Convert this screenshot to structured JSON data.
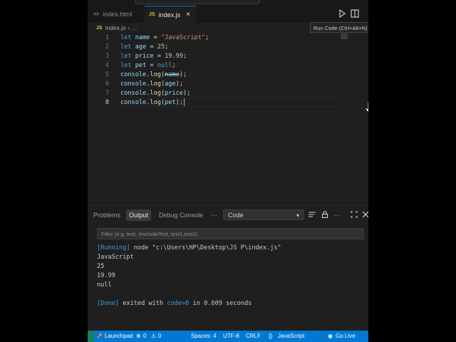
{
  "tabs": [
    {
      "icon": "<>",
      "label": "index.html",
      "active": false
    },
    {
      "icon": "JS",
      "label": "index.js",
      "active": true
    }
  ],
  "breadcrumb": {
    "file": "index.js",
    "sep": "›",
    "rest": "..."
  },
  "tooltip": "Run Code (Ctrl+Alt+N)",
  "editor": {
    "lines": [
      {
        "n": "1",
        "parts": [
          [
            "let",
            "kw"
          ],
          [
            " ",
            ""
          ],
          [
            "name",
            "var"
          ],
          [
            " = ",
            ""
          ],
          [
            "\"JavaScript\"",
            "str"
          ],
          [
            ";",
            ""
          ]
        ]
      },
      {
        "n": "2",
        "parts": [
          [
            "let",
            "kw"
          ],
          [
            " ",
            ""
          ],
          [
            "age",
            "var"
          ],
          [
            " = ",
            ""
          ],
          [
            "25",
            "num"
          ],
          [
            ";",
            ""
          ]
        ]
      },
      {
        "n": "3",
        "parts": [
          [
            "let",
            "kw"
          ],
          [
            " ",
            ""
          ],
          [
            "price",
            "var"
          ],
          [
            " = ",
            ""
          ],
          [
            "19.99",
            "num"
          ],
          [
            ";",
            ""
          ]
        ]
      },
      {
        "n": "4",
        "parts": [
          [
            "let",
            "kw"
          ],
          [
            " ",
            ""
          ],
          [
            "pet",
            "var"
          ],
          [
            " = ",
            ""
          ],
          [
            "null",
            "kw"
          ],
          [
            ";",
            ""
          ]
        ]
      },
      {
        "n": "5",
        "parts": [
          [
            "console",
            "var"
          ],
          [
            ".",
            ""
          ],
          [
            "log",
            "fn"
          ],
          [
            "(",
            ""
          ],
          [
            "name",
            "var strike"
          ],
          [
            ");",
            ""
          ]
        ]
      },
      {
        "n": "6",
        "parts": [
          [
            "console",
            "var"
          ],
          [
            ".",
            ""
          ],
          [
            "log",
            "fn"
          ],
          [
            "(",
            ""
          ],
          [
            "age",
            "var"
          ],
          [
            ");",
            ""
          ]
        ]
      },
      {
        "n": "7",
        "parts": [
          [
            "console",
            "var"
          ],
          [
            ".",
            ""
          ],
          [
            "log",
            "fn"
          ],
          [
            "(",
            ""
          ],
          [
            "price",
            "var"
          ],
          [
            ");",
            ""
          ]
        ]
      },
      {
        "n": "8",
        "parts": [
          [
            "console",
            "var"
          ],
          [
            ".",
            ""
          ],
          [
            "log",
            "fn"
          ],
          [
            "(",
            ""
          ],
          [
            "pet",
            "var"
          ],
          [
            ");",
            ""
          ]
        ],
        "current": true
      }
    ]
  },
  "panel": {
    "tabs": {
      "problems": "Problems",
      "output": "Output",
      "debug": "Debug Console",
      "more": "···"
    },
    "select_value": "Code",
    "filter_placeholder": "Filter (e.g. text, !excludeText, text1,text2)",
    "output": [
      {
        "parts": [
          [
            "[Running]",
            "blue"
          ],
          [
            " node \"c:\\Users\\HP\\Desktop\\JS P\\index.js\"",
            ""
          ]
        ]
      },
      {
        "parts": [
          [
            "JavaScript",
            ""
          ]
        ]
      },
      {
        "parts": [
          [
            "25",
            ""
          ]
        ]
      },
      {
        "parts": [
          [
            "19.99",
            ""
          ]
        ]
      },
      {
        "parts": [
          [
            "null",
            ""
          ]
        ]
      },
      {
        "parts": [
          [
            "",
            ""
          ]
        ]
      },
      {
        "parts": [
          [
            "[Done]",
            "blue"
          ],
          [
            " exited with ",
            ""
          ],
          [
            "code=0",
            "blue"
          ],
          [
            " in ",
            ""
          ],
          [
            "0.609",
            "onum"
          ],
          [
            " seconds",
            ""
          ]
        ]
      }
    ]
  },
  "statusbar": {
    "launchpad": "Launchpad",
    "errors": "0",
    "warnings": "0",
    "spaces": "Spaces: 4",
    "encoding": "UTF-8",
    "eol": "CRLF",
    "language": "JavaScript",
    "golive": "Go Live"
  },
  "colors": {
    "accent": "#0078d4",
    "statusbar": "#0078d4",
    "editor_bg": "#1f1f1f"
  }
}
